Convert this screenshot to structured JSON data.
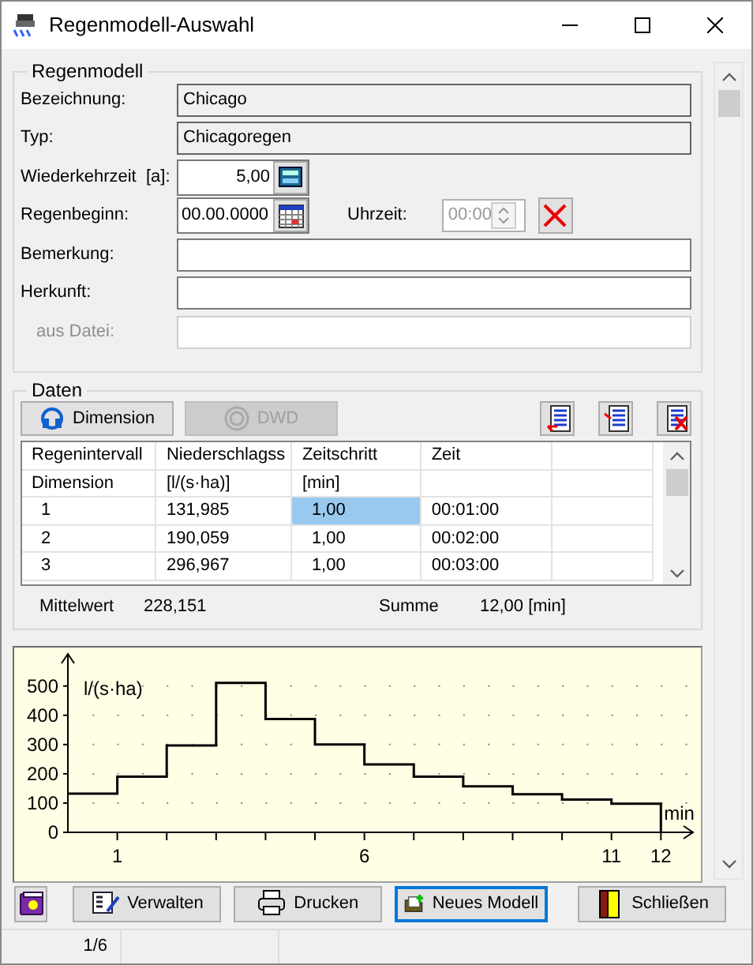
{
  "window": {
    "title": "Regenmodell-Auswahl"
  },
  "regenmodell": {
    "title": "Regenmodell",
    "fields": [
      {
        "kind": "text",
        "label": "Bezeichnung:",
        "value": "Chicago",
        "readonly": true,
        "disabled": false
      },
      {
        "kind": "text",
        "label": "Typ:",
        "value": "Chicagoregen",
        "readonly": true,
        "disabled": false
      },
      {
        "kind": "number",
        "label": "Wiederkehrzeit  [a]:",
        "value": "5,00"
      },
      {
        "kind": "date",
        "label": "Regenbeginn:",
        "value": "00.00.0000",
        "time_label": "Uhrzeit:",
        "time_value": "00:00",
        "time_disabled": true
      },
      {
        "kind": "text",
        "label": "Bemerkung:",
        "readonly": false,
        "disabled": false
      },
      {
        "kind": "text",
        "label": "Herkunft:",
        "readonly": false,
        "disabled": false
      },
      {
        "kind": "text",
        "label": "aus Datei:",
        "readonly": false,
        "disabled": true
      }
    ]
  },
  "daten": {
    "title": "Daten",
    "buttons": [
      {
        "label": "Dimension",
        "disabled": false
      },
      {
        "label": "DWD",
        "disabled": true
      }
    ],
    "table": {
      "columns": [
        {
          "name": "Regenintervall",
          "unit": "Dimension"
        },
        {
          "name": "Niederschlagss",
          "unit": "[l/(s·ha)]"
        },
        {
          "name": "Zeitschritt",
          "unit": "[min]"
        },
        {
          "name": "Zeit"
        }
      ],
      "rows": [
        {
          "cells": [
            {
              "text": "1",
              "selected": false
            },
            {
              "text": "131,985",
              "selected": false
            },
            {
              "text": "1,00",
              "selected": true
            },
            {
              "text": "00:01:00",
              "selected": false
            }
          ]
        },
        {
          "cells": [
            {
              "text": "2",
              "selected": false
            },
            {
              "text": "190,059",
              "selected": false
            },
            {
              "text": "1,00",
              "selected": false
            },
            {
              "text": "00:02:00",
              "selected": false
            }
          ]
        },
        {
          "cells": [
            {
              "text": "3",
              "selected": false
            },
            {
              "text": "296,967",
              "selected": false
            },
            {
              "text": "1,00",
              "selected": false
            },
            {
              "text": "00:03:00",
              "selected": false
            }
          ]
        }
      ]
    },
    "summary": {
      "mean_label": "Mittelwert",
      "mean": "228,151",
      "sum_label": "Summe",
      "sum": "12,00 [min]"
    }
  },
  "chart_data": {
    "type": "line",
    "ylabel": "l/(s·ha)",
    "xlabel": "min",
    "x": [
      0,
      1,
      1,
      2,
      2,
      3,
      3,
      4,
      4,
      5,
      5,
      6,
      6,
      7,
      7,
      8,
      8,
      9,
      9,
      10,
      10,
      11,
      11,
      12,
      12
    ],
    "series": [
      {
        "color": "#000000",
        "values": [
          132,
          132,
          190,
          190,
          297,
          297,
          511,
          511,
          387,
          387,
          300,
          300,
          232,
          232,
          190,
          190,
          157,
          157,
          130,
          130,
          112,
          112,
          98,
          98,
          0
        ]
      }
    ],
    "xlim": [
      0,
      12.65
    ],
    "ylim": [
      0,
      610
    ],
    "grid": true,
    "xticks": [
      1,
      6,
      11,
      12
    ],
    "yticks": [
      0,
      100,
      200,
      300,
      400,
      500
    ]
  },
  "buttons": [
    {
      "kind": "help",
      "focused": false
    },
    {
      "kind": "manage",
      "label": "Verwalten",
      "focused": false
    },
    {
      "kind": "print",
      "label": "Drucken",
      "focused": false
    },
    {
      "kind": "new",
      "label": "Neues Modell",
      "focused": true
    },
    {
      "kind": "exit",
      "label": "Schließen",
      "focused": false
    }
  ],
  "status_bar": {
    "text": "1/6"
  }
}
